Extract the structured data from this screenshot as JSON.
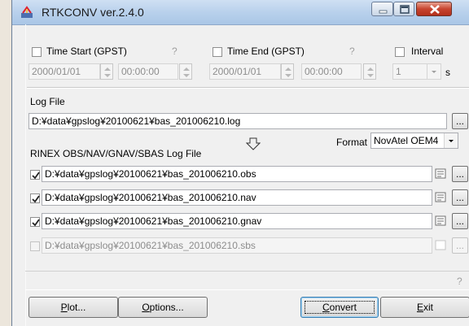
{
  "window": {
    "title": "RTKCONV ver.2.4.0"
  },
  "time": {
    "start": {
      "label": "Time Start (GPST)",
      "help": "?",
      "date": "2000/01/01",
      "time": "00:00:00"
    },
    "end": {
      "label": "Time End (GPST)",
      "help": "?",
      "date": "2000/01/01",
      "time": "00:00:00"
    },
    "interval": {
      "label": "Interval",
      "value": "1",
      "unit": "s"
    }
  },
  "log": {
    "label": "Log File",
    "path": "D:¥data¥gpslog¥20100621¥bas_201006210.log",
    "browse": "..."
  },
  "format": {
    "label": "Format",
    "value": "NovAtel OEM4"
  },
  "rinex": {
    "label": "RINEX OBS/NAV/GNAV/SBAS Log File",
    "files": [
      {
        "path": "D:¥data¥gpslog¥20100621¥bas_201006210.obs",
        "checked": true,
        "enabled": true,
        "browse": "..."
      },
      {
        "path": "D:¥data¥gpslog¥20100621¥bas_201006210.nav",
        "checked": true,
        "enabled": true,
        "browse": "..."
      },
      {
        "path": "D:¥data¥gpslog¥20100621¥bas_201006210.gnav",
        "checked": true,
        "enabled": true,
        "browse": "..."
      },
      {
        "path": "D:¥data¥gpslog¥20100621¥bas_201006210.sbs",
        "checked": false,
        "enabled": false,
        "browse": "..."
      }
    ]
  },
  "status": {
    "help": "?"
  },
  "buttons": {
    "plot": {
      "mnemonic": "P",
      "rest": "lot..."
    },
    "options": {
      "mnemonic": "O",
      "rest": "ptions..."
    },
    "convert": {
      "mnemonic": "C",
      "rest": "onvert"
    },
    "exit": {
      "mnemonic": "E",
      "rest": "xit"
    }
  },
  "colors": {
    "titlebar": "#b9d1ec",
    "close": "#c7452f",
    "dialog": "#f0f0f0"
  }
}
